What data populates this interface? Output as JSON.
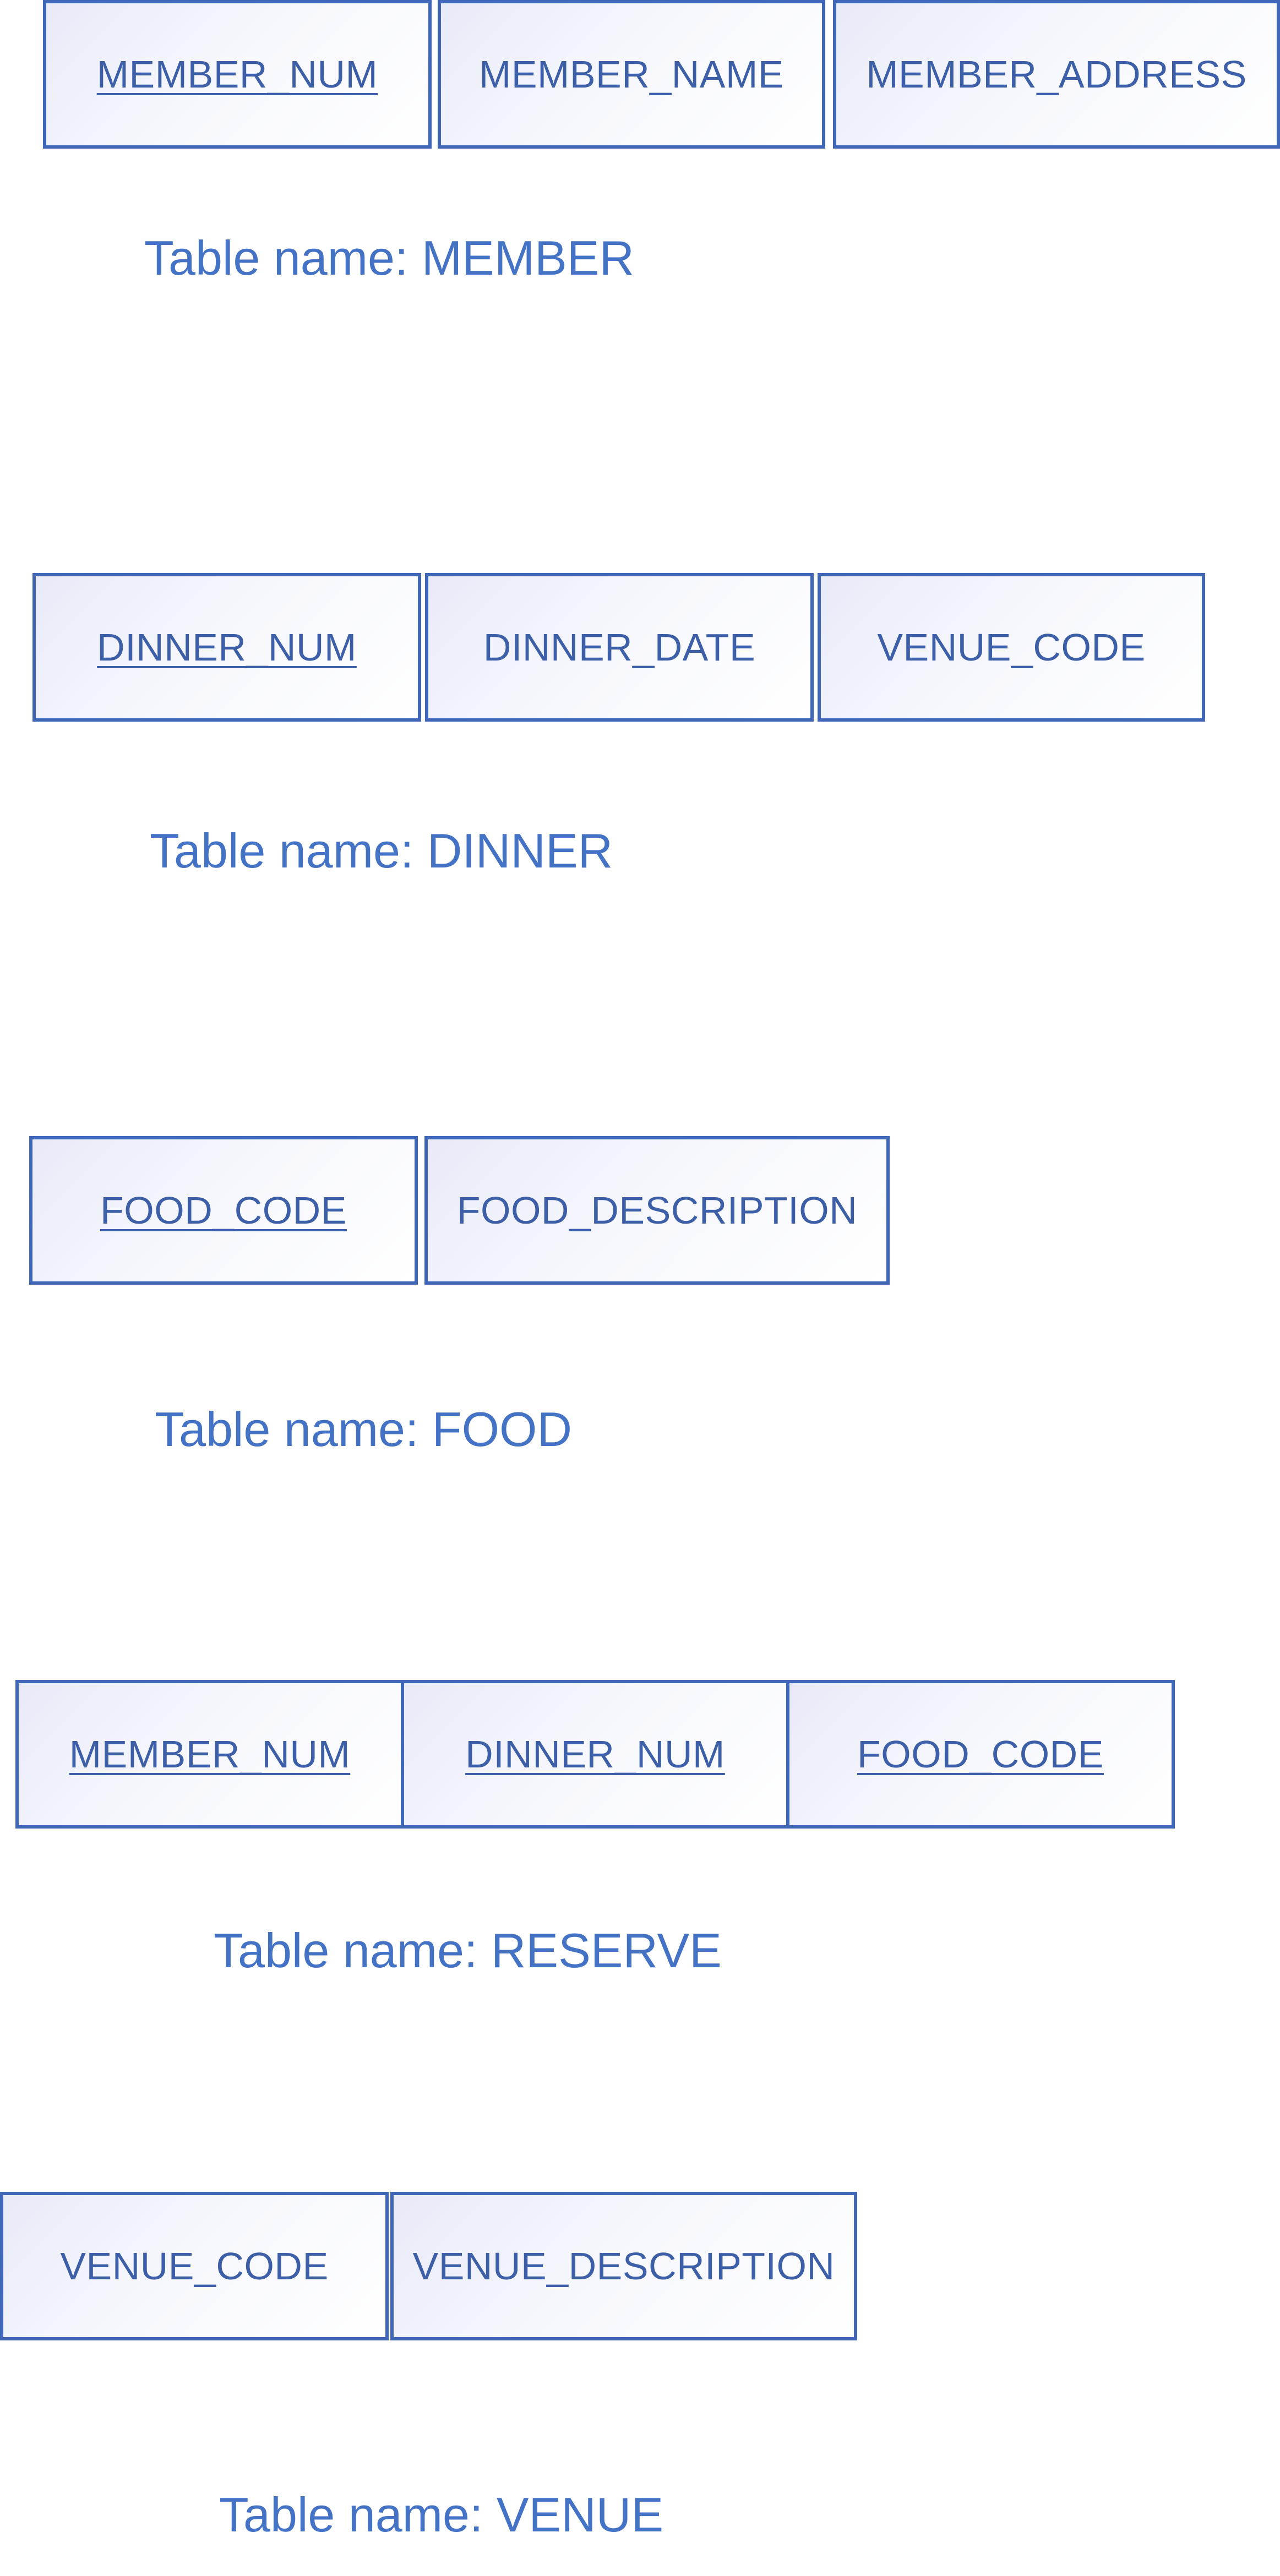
{
  "tables": [
    {
      "caption": "Table name: MEMBER",
      "fields": [
        {
          "label": "MEMBER_NUM",
          "primary_key": true
        },
        {
          "label": "MEMBER_NAME",
          "primary_key": false
        },
        {
          "label": "MEMBER_ADDRESS",
          "primary_key": false
        }
      ]
    },
    {
      "caption": "Table name: DINNER",
      "fields": [
        {
          "label": "DINNER_NUM",
          "primary_key": true
        },
        {
          "label": "DINNER_DATE",
          "primary_key": false
        },
        {
          "label": "VENUE_CODE",
          "primary_key": false
        }
      ]
    },
    {
      "caption": "Table name: FOOD",
      "fields": [
        {
          "label": "FOOD_CODE",
          "primary_key": true
        },
        {
          "label": "FOOD_DESCRIPTION",
          "primary_key": false
        }
      ]
    },
    {
      "caption": "Table name: RESERVE",
      "fields": [
        {
          "label": "MEMBER_NUM",
          "primary_key": true
        },
        {
          "label": "DINNER_NUM",
          "primary_key": true
        },
        {
          "label": "FOOD_CODE",
          "primary_key": true
        }
      ]
    },
    {
      "caption": "Table name: VENUE",
      "fields": [
        {
          "label": "VENUE_CODE",
          "primary_key": false
        },
        {
          "label": "VENUE_DESCRIPTION",
          "primary_key": false
        }
      ]
    }
  ],
  "colors": {
    "box_border": "#4066b8",
    "field_text": "#3d5fa8",
    "caption_text": "#4472c4"
  }
}
